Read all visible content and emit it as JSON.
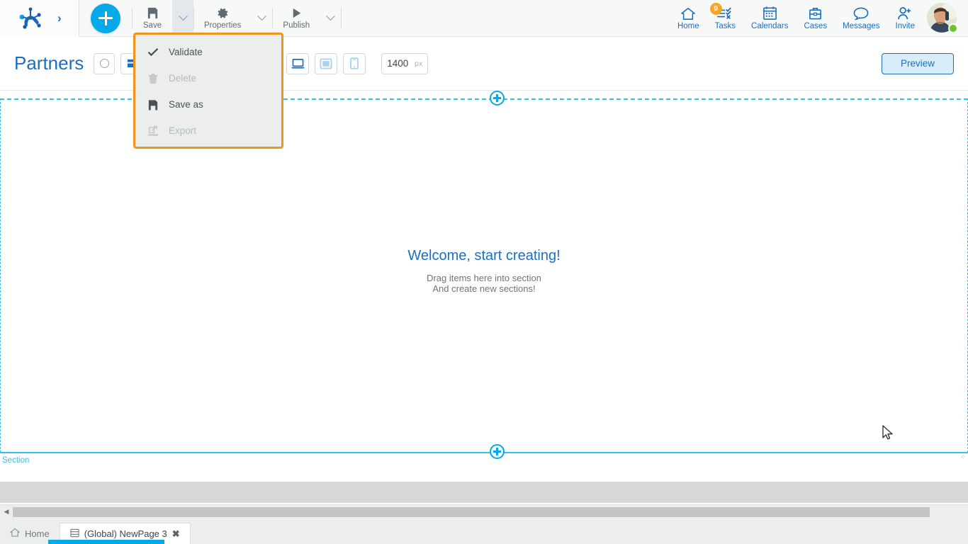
{
  "app": {
    "logo_name": "frog-logo",
    "expand_chevron": "›"
  },
  "toolbar": {
    "add_button": "add-plus-button",
    "items": [
      {
        "label": "Save",
        "icon": "save-icon",
        "has_caret": true,
        "caret_active": true
      },
      {
        "label": "Properties",
        "icon": "gear-icon",
        "has_caret": true,
        "caret_active": false
      },
      {
        "label": "Publish",
        "icon": "play-icon",
        "has_caret": true,
        "caret_active": false
      }
    ]
  },
  "save_menu": {
    "items": [
      {
        "label": "Validate",
        "icon": "check-icon",
        "disabled": false
      },
      {
        "label": "Delete",
        "icon": "trash-icon",
        "disabled": true
      },
      {
        "label": "Save as",
        "icon": "save-icon",
        "disabled": false
      },
      {
        "label": "Export",
        "icon": "export-icon",
        "disabled": true
      }
    ],
    "highlight_color": "#f5921e"
  },
  "nav": {
    "items": [
      {
        "label": "Home",
        "icon": "home-icon",
        "badge": ""
      },
      {
        "label": "Tasks",
        "icon": "tasks-icon",
        "badge": "9"
      },
      {
        "label": "Calendars",
        "icon": "calendar-icon",
        "badge": ""
      },
      {
        "label": "Cases",
        "icon": "briefcase-icon",
        "badge": ""
      },
      {
        "label": "Messages",
        "icon": "speech-bubble-icon",
        "badge": ""
      },
      {
        "label": "Invite",
        "icon": "person-plus-icon",
        "badge": ""
      }
    ],
    "avatar": {
      "name": "user-avatar",
      "status": "online",
      "status_color": "#6fc22c"
    },
    "badge_color": "#f5a623",
    "link_color": "#1a6fc4"
  },
  "subbar": {
    "title": "Partners",
    "circle_button": "record-circle-button",
    "undo": "undo-button",
    "redo": "redo-button",
    "devices": [
      {
        "name": "desktop-view-button",
        "selected": true
      },
      {
        "name": "tablet-view-button",
        "selected": false
      },
      {
        "name": "mobile-view-button",
        "selected": false
      }
    ],
    "width_value": "1400",
    "width_unit": "px",
    "preview_label": "Preview"
  },
  "canvas": {
    "welcome_title": "Welcome, start creating!",
    "welcome_line1": "Drag items here into section",
    "welcome_line2": "And create new sections!",
    "section_label": "Section",
    "add_section_top": "add-section-top-button",
    "add_section_bottom": "add-section-bottom-button",
    "accent_color": "#35c0ea"
  },
  "bottom_tabs": {
    "tabs": [
      {
        "label": "Home",
        "icon": "home-icon",
        "active": false,
        "closable": false
      },
      {
        "label": "(Global) NewPage 3",
        "icon": "page-icon",
        "active": true,
        "closable": true,
        "close_glyph": "✖"
      }
    ],
    "active_color": "#03a9e8"
  },
  "scrollbar": {
    "left_arrow": "◀"
  }
}
